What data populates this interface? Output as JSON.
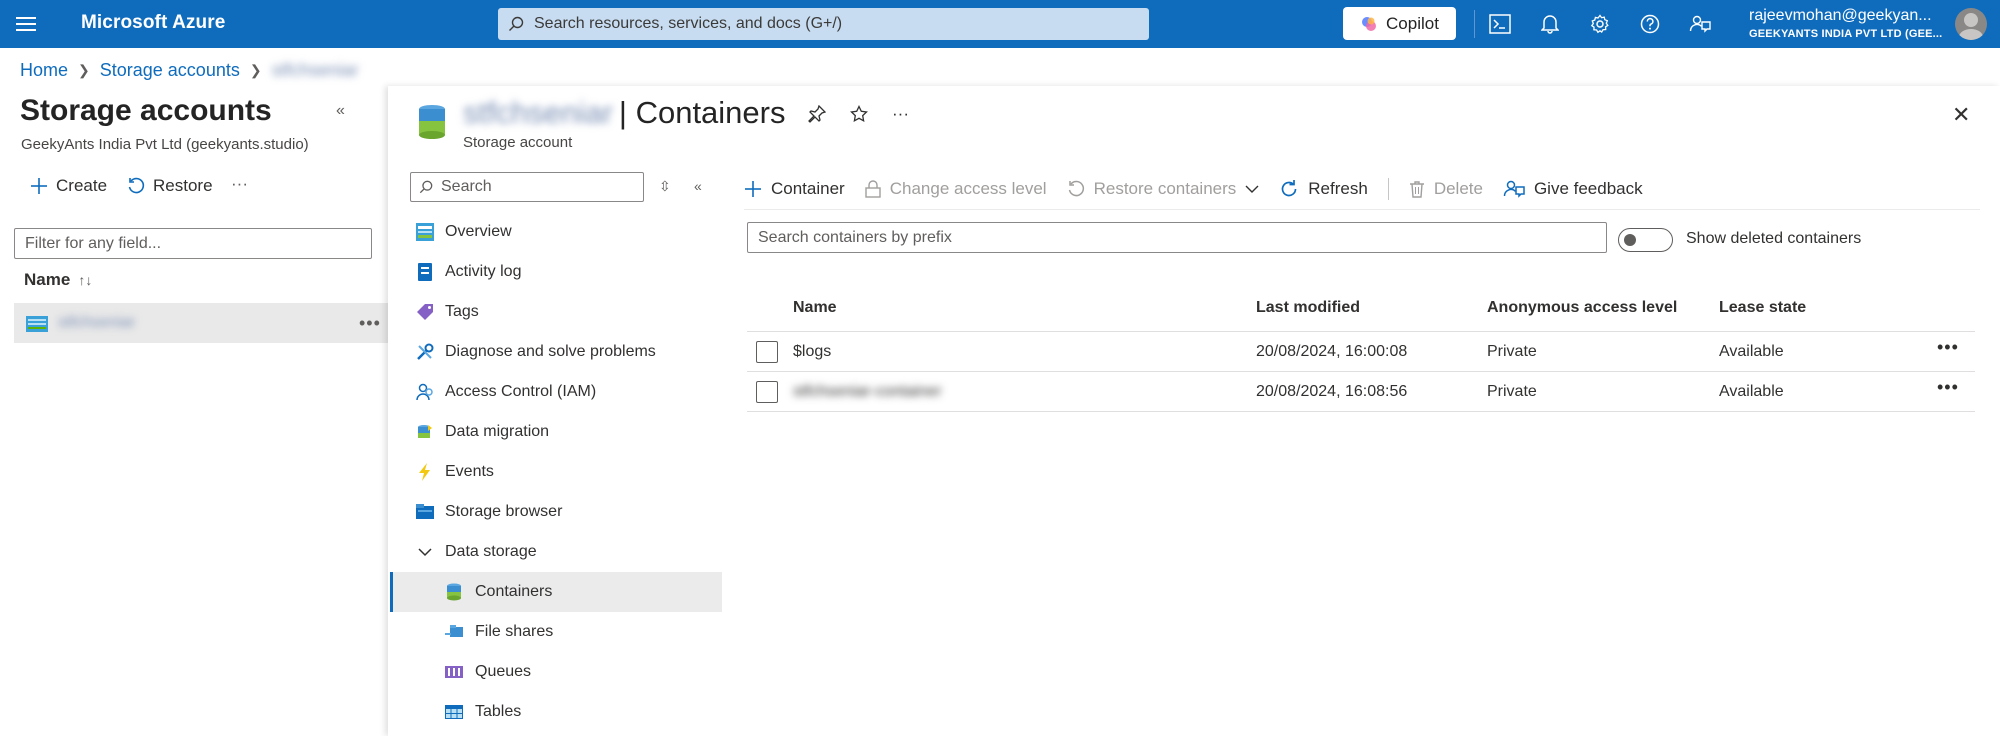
{
  "topbar": {
    "brand": "Microsoft Azure",
    "search_placeholder": "Search resources, services, and docs (G+/)",
    "copilot_label": "Copilot",
    "user_email": "rajeevmohan@geekyan...",
    "user_org": "GEEKYANTS INDIA PVT LTD (GEE...",
    "icons": [
      "menu-icon",
      "cloud-shell-icon",
      "bell-icon",
      "gear-icon",
      "help-icon",
      "feedback-icon"
    ]
  },
  "breadcrumb": {
    "home": "Home",
    "storage_accounts": "Storage accounts",
    "current": "stfchseniar"
  },
  "left_panel": {
    "title": "Storage accounts",
    "subtitle": "GeekyAnts India Pvt Ltd (geekyants.studio)",
    "create_label": "Create",
    "restore_label": "Restore",
    "more_label": "···",
    "filter_placeholder": "Filter for any field...",
    "name_header": "Name",
    "selected_account": "stfchseniar"
  },
  "blade": {
    "account_name": "stfchseniar",
    "title_suffix": "| Containers",
    "subtitle": "Storage account",
    "more_label": "···"
  },
  "resource_menu": {
    "search_placeholder": "Search",
    "items": [
      {
        "label": "Overview",
        "icon": "overview-icon"
      },
      {
        "label": "Activity log",
        "icon": "activity-log-icon"
      },
      {
        "label": "Tags",
        "icon": "tag-icon"
      },
      {
        "label": "Diagnose and solve problems",
        "icon": "wrench-icon"
      },
      {
        "label": "Access Control (IAM)",
        "icon": "iam-icon"
      },
      {
        "label": "Data migration",
        "icon": "data-migration-icon"
      },
      {
        "label": "Events",
        "icon": "lightning-icon"
      },
      {
        "label": "Storage browser",
        "icon": "storage-browser-icon"
      },
      {
        "label": "Data storage",
        "icon": "chevron-down-icon"
      },
      {
        "label": "Containers",
        "icon": "container-icon"
      },
      {
        "label": "File shares",
        "icon": "file-share-icon"
      },
      {
        "label": "Queues",
        "icon": "queue-icon"
      },
      {
        "label": "Tables",
        "icon": "table-icon"
      }
    ]
  },
  "toolbar": {
    "container": "Container",
    "change_access": "Change access level",
    "restore_containers": "Restore containers",
    "refresh": "Refresh",
    "delete": "Delete",
    "give_feedback": "Give feedback"
  },
  "containers": {
    "search_placeholder": "Search containers by prefix",
    "toggle_label": "Show deleted containers",
    "show_deleted": false,
    "headers": {
      "name": "Name",
      "last_modified": "Last modified",
      "access": "Anonymous access level",
      "lease": "Lease state"
    },
    "rows": [
      {
        "name": "$logs",
        "last_modified": "20/08/2024, 16:00:08",
        "access": "Private",
        "lease": "Available"
      },
      {
        "name": "stfchseniar-container",
        "last_modified": "20/08/2024, 16:08:56",
        "access": "Private",
        "lease": "Available"
      }
    ]
  },
  "colors": {
    "topbar": "#0f6cbd",
    "link": "#0f6cbd",
    "search_bg": "#c7dcf0"
  }
}
